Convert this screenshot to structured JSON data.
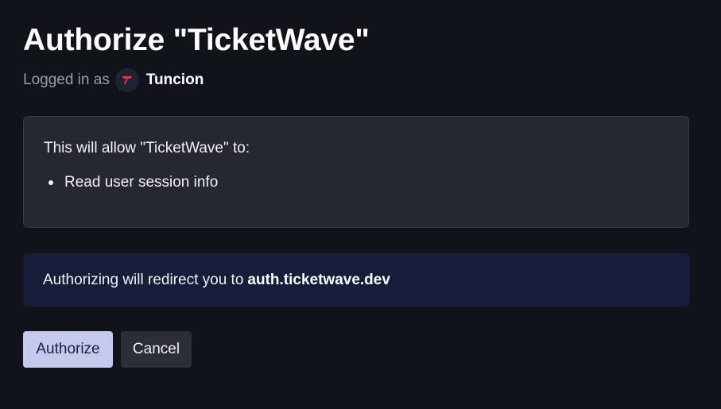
{
  "dialog": {
    "title": "Authorize \"TicketWave\"",
    "logged_in_label": "Logged in as",
    "username": "Tuncion",
    "avatar_icon": "tuncion-logo-icon",
    "avatar_color": "#e8334a"
  },
  "scopes": {
    "intro": "This will allow \"TicketWave\" to:",
    "items": [
      {
        "label": "Read user session info"
      }
    ]
  },
  "redirect": {
    "text": "Authorizing will redirect you to",
    "domain": "auth.ticketwave.dev"
  },
  "actions": {
    "authorize_label": "Authorize",
    "cancel_label": "Cancel"
  },
  "colors": {
    "background": "#12131a",
    "accent_button": "#c4c9ee",
    "redirect_panel": "#161d3b"
  }
}
